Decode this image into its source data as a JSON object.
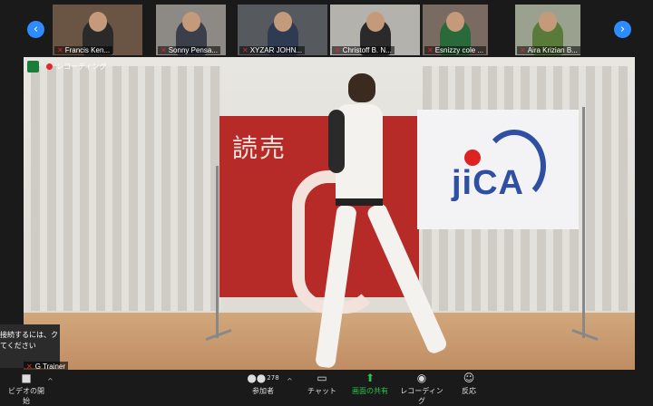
{
  "participants": [
    {
      "name": "Francis Ken...",
      "bg": "#6a5443",
      "shirt": "#2a2a2a"
    },
    {
      "name": "Sonny Pensa...",
      "bg": "#8d8a86",
      "shirt": "#3a3f4a"
    },
    {
      "name": "XYZAR JOHN...",
      "bg": "#565a5e",
      "shirt": "#2f3b52"
    },
    {
      "name": "Christoff B. N...",
      "bg": "#b4b2ad",
      "shirt": "#2a2a2a"
    },
    {
      "name": "Esnizzy cole ...",
      "bg": "#7a6b62",
      "shirt": "#2a6a3a"
    },
    {
      "name": "Aira Krizian B...",
      "bg": "#9aa28f",
      "shirt": "#5a7a3a"
    }
  ],
  "nav": {
    "prev_icon": "chevron-left-icon",
    "next_icon": "chevron-right-icon",
    "prev_glyph": "‹",
    "next_glyph": "›"
  },
  "recording": {
    "label": "レコーディング"
  },
  "scene": {
    "banner_left_text": "読売",
    "banner_right_text": "jiCA"
  },
  "tooltip": {
    "line1": "接続するには、ク",
    "line2": "てください"
  },
  "self_view": {
    "name": "G Trainer"
  },
  "toolbar": {
    "video_label": "ビデオの開始",
    "participants_label": "参加者",
    "participants_count": "278",
    "chat_label": "チャット",
    "share_label": "画面の共有",
    "record_label": "レコーディング",
    "reactions_label": "反応"
  },
  "colors": {
    "accent": "#2d8cff",
    "share_green": "#27c24c",
    "muted_red": "#e02828",
    "toolbar_bg": "#1a1a1a"
  }
}
